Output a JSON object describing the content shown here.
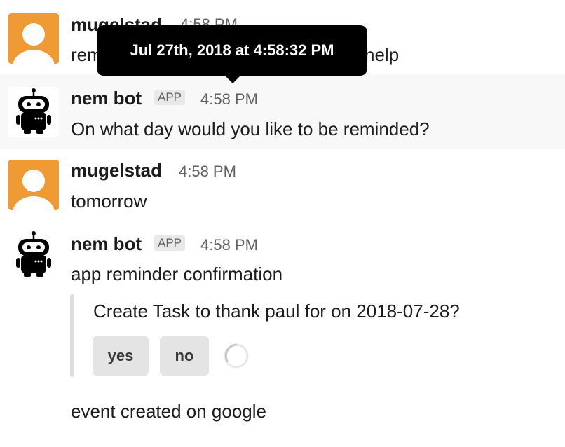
{
  "messages": [
    {
      "author": "mugelstad",
      "time": "4:58 PM",
      "text_start": "rem",
      "text_end": "help"
    },
    {
      "author": "nem bot",
      "badge": "APP",
      "time": "4:58 PM",
      "text": "On what day would you like to be reminded?"
    },
    {
      "author": "mugelstad",
      "time": "4:58 PM",
      "text": "tomorrow"
    },
    {
      "author": "nem bot",
      "badge": "APP",
      "time": "4:58 PM",
      "text": "app reminder confirmation",
      "attachment": {
        "text": "Create Task to thank paul for on 2018-07-28?",
        "buttons": [
          {
            "label": "yes"
          },
          {
            "label": "no"
          }
        ]
      }
    }
  ],
  "tooltip": {
    "text": "Jul 27th, 2018 at 4:58:32 PM"
  },
  "footer_text": "event created on google",
  "colors": {
    "user_avatar": "#ef9a35",
    "hover_row": "#f8f8f8",
    "tooltip_bg": "#000000",
    "button_bg": "#e4e4e4"
  }
}
